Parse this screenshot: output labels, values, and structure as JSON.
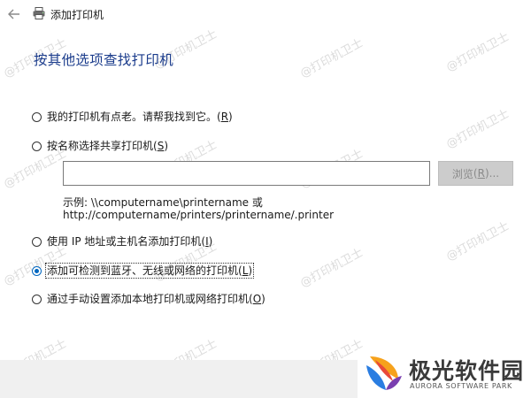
{
  "window": {
    "title": "添加打印机"
  },
  "heading": "按其他选项查找打印机",
  "options": [
    {
      "label": "我的打印机有点老。请帮我找到它。",
      "accel": "R",
      "selected": false
    },
    {
      "label": "按名称选择共享打印机",
      "accel": "S",
      "selected": false
    },
    {
      "label": "使用 IP 地址或主机名添加打印机",
      "accel": "I",
      "selected": false
    },
    {
      "label": "添加可检测到蓝牙、无线或网络的打印机",
      "accel": "L",
      "selected": true
    },
    {
      "label": "通过手动设置添加本地打印机或网络打印机",
      "accel": "O",
      "selected": false
    }
  ],
  "shared_printer": {
    "input_value": "",
    "browse_label": "浏览",
    "browse_accel": "R",
    "browse_suffix": "...",
    "example_line1": "示例: \\\\computername\\printername 或",
    "example_line2": "http://computername/printers/printername/.printer"
  },
  "watermark": {
    "text": "@打印机卫士"
  },
  "logo": {
    "name": "极光软件园",
    "subtitle": "AURORA SOFTWARE PARK"
  },
  "colors": {
    "heading": "#1b3c8c",
    "radio_selected": "#0067c0",
    "footer": "#f0f0f0",
    "disabled_button": "#cccccc"
  }
}
